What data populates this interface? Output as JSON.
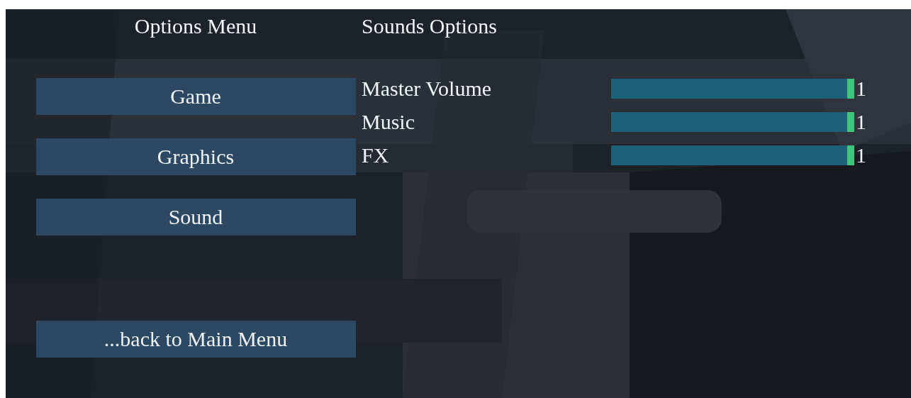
{
  "options_menu": {
    "title": "Options Menu",
    "buttons": [
      {
        "label": "Game"
      },
      {
        "label": "Graphics"
      },
      {
        "label": "Sound"
      }
    ],
    "back_button": "...back to Main Menu"
  },
  "sounds_options": {
    "title": "Sounds Options",
    "sliders": [
      {
        "label": "Master Volume",
        "level": 1,
        "reading": "1"
      },
      {
        "label": "Music",
        "level": 1,
        "reading": "1"
      },
      {
        "label": "FX",
        "level": 1,
        "reading": "1"
      }
    ]
  }
}
